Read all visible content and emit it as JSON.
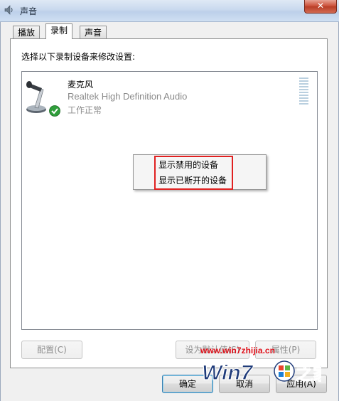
{
  "window": {
    "title": "声音",
    "close_glyph": "✕"
  },
  "tabs": [
    {
      "label": "播放",
      "active": false
    },
    {
      "label": "录制",
      "active": true
    },
    {
      "label": "声音",
      "active": false
    }
  ],
  "panel": {
    "instruction": "选择以下录制设备来修改设置:"
  },
  "device": {
    "name": "麦克风",
    "driver": "Realtek High Definition Audio",
    "status": "工作正常",
    "icon": "microphone-icon",
    "status_icon": "green-check-icon"
  },
  "context_menu": {
    "items": [
      "显示禁用的设备",
      "显示已断开的设备"
    ]
  },
  "buttons": {
    "configure": "配置(C)",
    "set_default": "设为默认值(S)",
    "properties": "属性(P)",
    "ok": "确定",
    "cancel": "取消",
    "apply": "应用(A)"
  },
  "watermark": {
    "url": "www.win7zhijia.cn",
    "logo_text": "Win7",
    "logo_suffix": "之家"
  },
  "colors": {
    "accent": "#3c7fb1",
    "highlight_border": "#e02020",
    "watermark": "#e0101a"
  }
}
